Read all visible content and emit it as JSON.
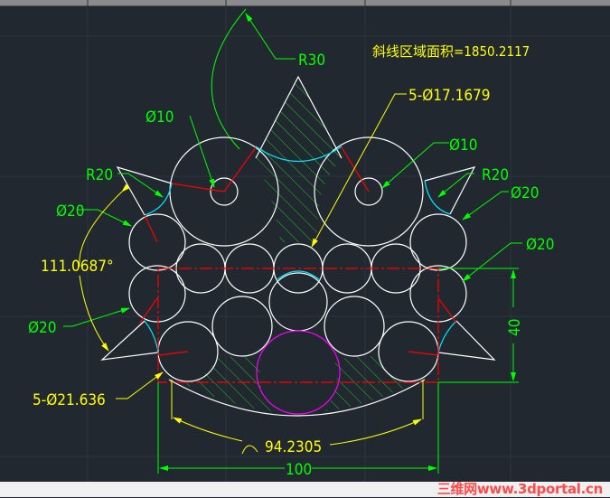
{
  "drawing": {
    "area_note": "斜线区域面积=1850.2117",
    "labels": {
      "r30": "R30",
      "small_circles": "5-Ø17.1679",
      "phi10_left": "Ø10",
      "phi10_right": "Ø10",
      "r20_left": "R20",
      "r20_right": "R20",
      "phi20_left_upper": "Ø20",
      "phi20_right_upper": "Ø20",
      "phi20_right_mid": "Ø20",
      "phi20_left_mid": "Ø20",
      "angle": "111.0687°",
      "bottom_circles": "5-Ø21.636",
      "arc_length": "94.2305",
      "width": "100",
      "height": "40"
    }
  },
  "watermark": "三维网www.3dportal.cn",
  "colors": {
    "background": "#212830",
    "geometry": "#ffffff",
    "dimension": "#00ff00",
    "annotation": "#ffff00",
    "centerline": "#ff0000",
    "tangent_arc": "#00e5ff",
    "highlight_circle": "#ff00ff"
  }
}
